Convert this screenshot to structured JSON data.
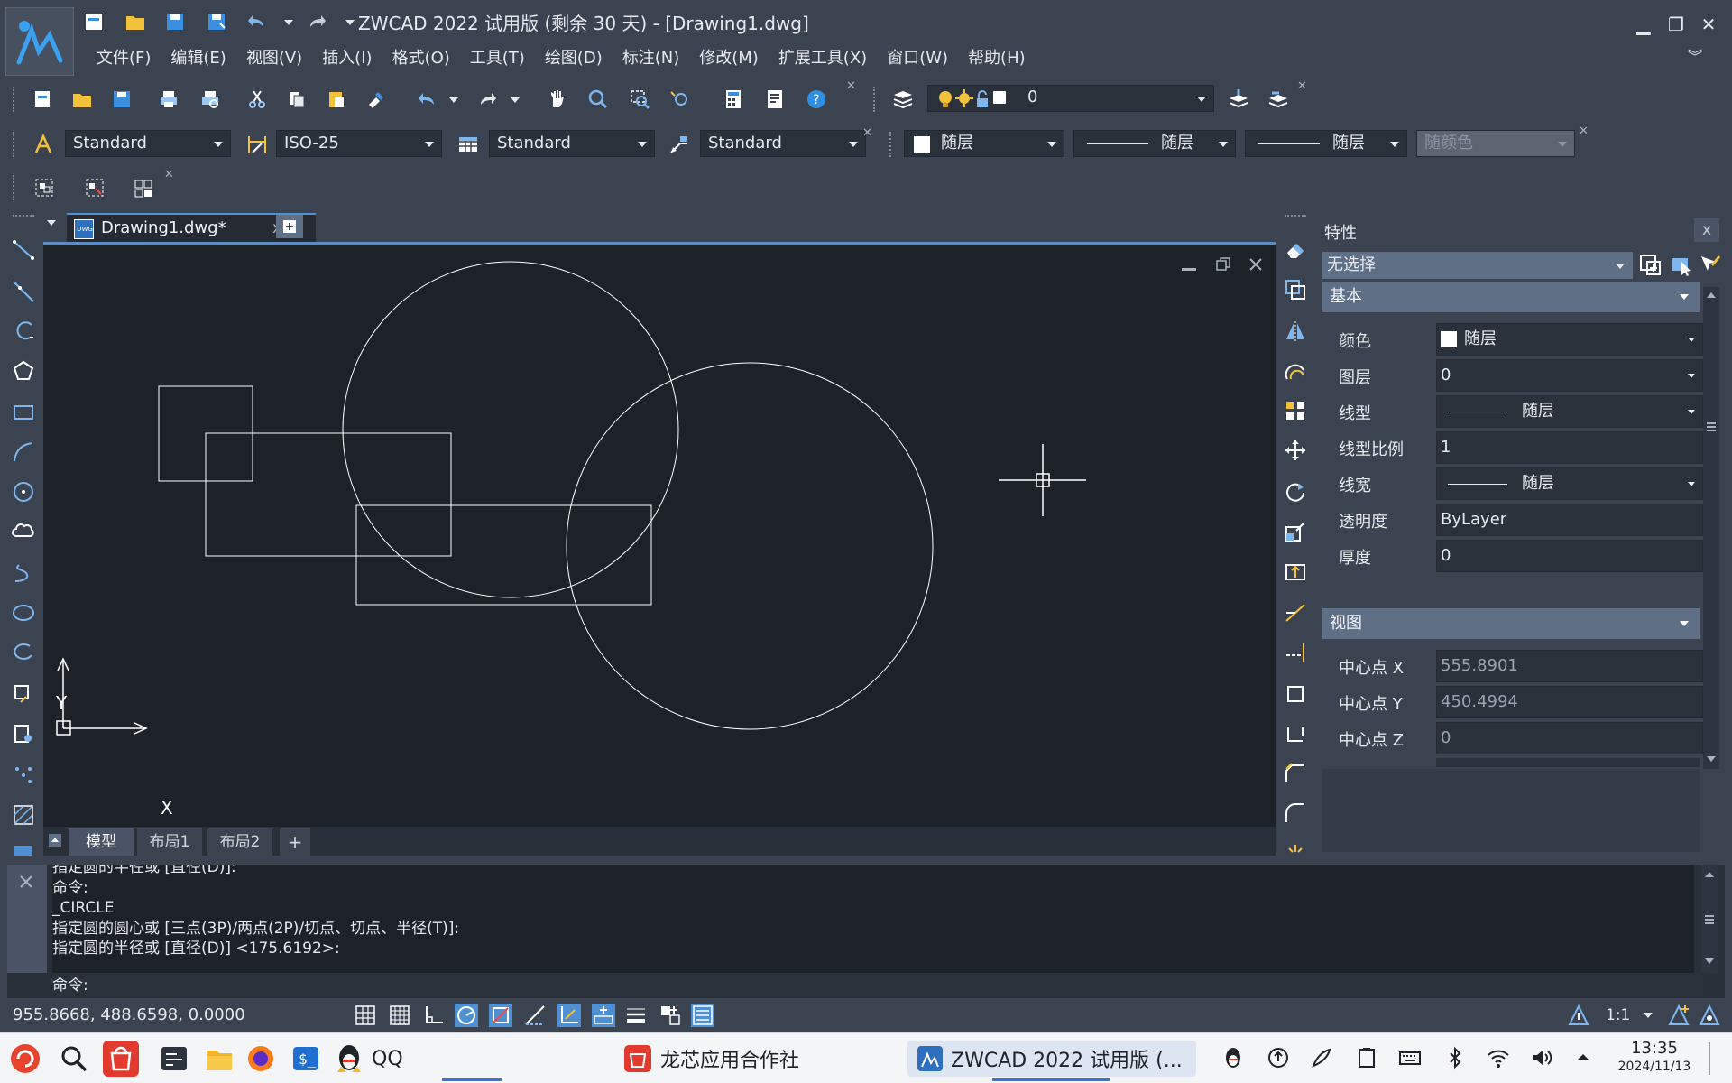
{
  "window": {
    "title": "ZWCAD 2022 试用版 (剩余 30 天) - [Drawing1.dwg]",
    "controls": {
      "minimize": "▁",
      "restore": "❐",
      "close": "✕",
      "expand": "︾"
    }
  },
  "menu": [
    "文件(F)",
    "编辑(E)",
    "视图(V)",
    "插入(I)",
    "格式(O)",
    "工具(T)",
    "绘图(D)",
    "标注(N)",
    "修改(M)",
    "扩展工具(X)",
    "窗口(W)",
    "帮助(H)"
  ],
  "toolbar": {
    "layer_value": "0",
    "text_style": "Standard",
    "dim_style": "ISO-25",
    "table_style": "Standard",
    "multileader_style": "Standard",
    "color": "随层",
    "linetype": "随层",
    "lineweight": "随层",
    "plot_style": "随颜色"
  },
  "doc_tab": {
    "label": "Drawing1.dwg*",
    "close": "x",
    "file_icon_text": "DWG"
  },
  "canvas": {
    "ucs_x": "X",
    "ucs_y": "Y"
  },
  "layout_tabs": [
    "模型",
    "布局1",
    "布局2"
  ],
  "layout_add": "+",
  "properties": {
    "title": "特性",
    "close": "x",
    "selection": "无选择",
    "basic_section": "基本",
    "basic": [
      {
        "label": "颜色",
        "value": "随层",
        "type": "color"
      },
      {
        "label": "图层",
        "value": "0",
        "type": "dropdown"
      },
      {
        "label": "线型",
        "value": "随层",
        "type": "line"
      },
      {
        "label": "线型比例",
        "value": "1",
        "type": "text"
      },
      {
        "label": "线宽",
        "value": "随层",
        "type": "line"
      },
      {
        "label": "透明度",
        "value": "ByLayer",
        "type": "text"
      },
      {
        "label": "厚度",
        "value": "0",
        "type": "text"
      }
    ],
    "view_section": "视图",
    "view": [
      {
        "label": "中心点 X",
        "value": "555.8901"
      },
      {
        "label": "中心点 Y",
        "value": "450.4994"
      },
      {
        "label": "中心点 Z",
        "value": "0"
      }
    ]
  },
  "command": {
    "lines": [
      "指定圆的半径或 [直径(D)]:",
      "命令:",
      "_CIRCLE",
      "指定圆的圆心或 [三点(3P)/两点(2P)/切点、切点、半径(T)]:",
      "指定圆的半径或 [直径(D)] <175.6192>:"
    ],
    "prompt": "命令:"
  },
  "status": {
    "coords": "955.8668, 488.6598, 0.0000",
    "scale": "1:1"
  },
  "taskbar": {
    "qq": "QQ",
    "longxin": "龙芯应用合作社",
    "zwcad": "ZWCAD 2022 试用版 (...",
    "time": "13:35",
    "date": "2024/11/13"
  },
  "colors": {
    "background": "#3b4350",
    "canvas": "#1d2229",
    "accent": "#2f8fe0",
    "section_header": "#5e6f86",
    "taskbar": "#f4f5f7"
  }
}
